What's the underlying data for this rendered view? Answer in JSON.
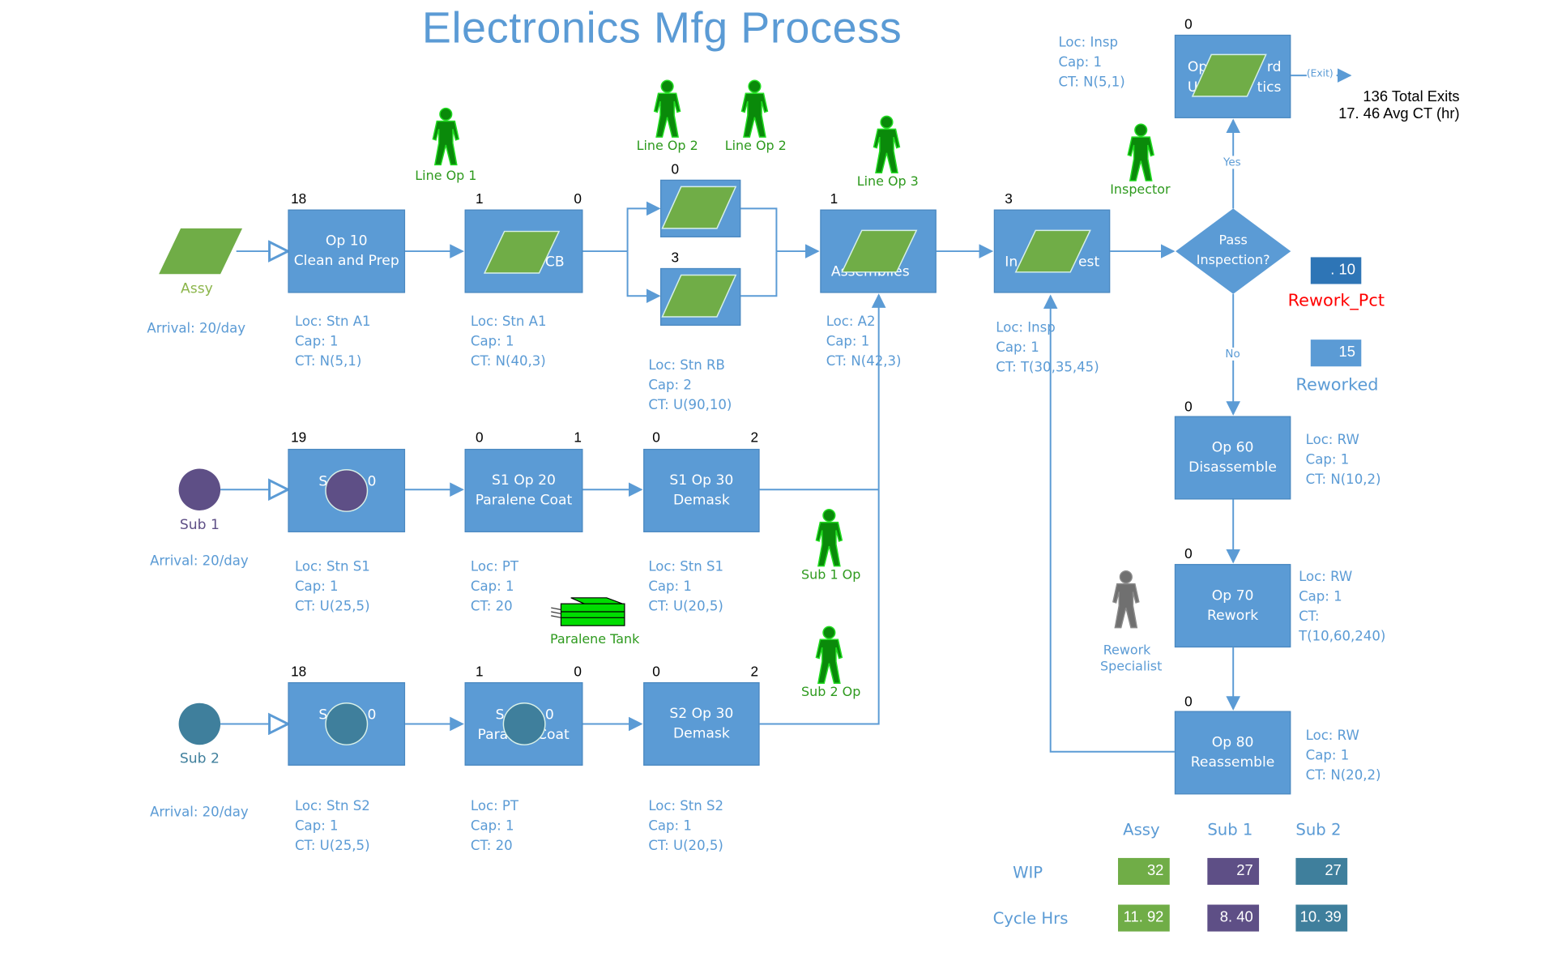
{
  "title": "Electronics Mfg Process",
  "colors": {
    "process_box": "#5b9bd5",
    "info_text": "#5b9bd5",
    "assy": "#70ad47",
    "sub1": "#5e4f86",
    "sub2": "#3f7f9c",
    "resource_green": "#0a8a0a",
    "resource_gray": "#707070",
    "rework_pct_label": "#ff0000",
    "rework_pct_box": "#2e75b6"
  },
  "entities": [
    {
      "name": "Assy",
      "shape": "parallelogram",
      "arrival": "Arrival: 20/day"
    },
    {
      "name": "Sub 1",
      "shape": "circle",
      "arrival": "Arrival: 20/day"
    },
    {
      "name": "Sub 2",
      "shape": "circle",
      "arrival": "Arrival: 20/day"
    }
  ],
  "resources": [
    {
      "name": "Line Op 1",
      "color": "green"
    },
    {
      "name": "Line Op 2",
      "color": "green"
    },
    {
      "name": "Line Op 2",
      "color": "green"
    },
    {
      "name": "Line Op 3",
      "color": "green"
    },
    {
      "name": "Inspector",
      "color": "green"
    },
    {
      "name": "Sub 1 Op",
      "color": "green"
    },
    {
      "name": "Sub 2 Op",
      "color": "green"
    },
    {
      "name": "Rework Specialist",
      "color": "gray"
    },
    {
      "name": "Paralene Tank",
      "color": "green",
      "icon": "tank"
    }
  ],
  "operations": {
    "op10": {
      "line1": "Op 10",
      "line2": "Clean and Prep",
      "count_left": "18",
      "count_right": "",
      "loc": "Loc: Stn A1",
      "cap": "Cap: 1",
      "ct": "CT: N(5,1)"
    },
    "op20": {
      "line1": "",
      "line2": "CB",
      "count_left": "1",
      "count_right": "0",
      "loc": "Loc: Stn A1",
      "cap": "Cap: 1",
      "ct": "CT: N(40,3)"
    },
    "op30a": {
      "count_left": "0",
      "loc": "",
      "cap": "",
      "ct": ""
    },
    "op30b": {
      "count_left": "3",
      "loc": "Loc: Stn RB",
      "cap": "Cap: 2",
      "ct": "CT: U(90,10)"
    },
    "op40": {
      "line2": "Assemblies",
      "count_left": "1",
      "loc": "Loc: A2",
      "cap": "Cap: 1",
      "ct": "CT: N(42,3)"
    },
    "op50": {
      "line1": "In",
      "line1b": "est",
      "count_left": "3",
      "loc": "Loc: Insp",
      "cap": "Cap: 1",
      "ct": "CT: T(30,35,45)"
    },
    "decision": {
      "line1": "Pass",
      "line2": "Inspection?",
      "yes": "Yes",
      "no": "No"
    },
    "op_final": {
      "line1a": "Op",
      "line1b": "rd",
      "line2a": "U",
      "line2b": "tics",
      "count_left": "0",
      "loc": "Loc: Insp",
      "cap": "Cap: 1",
      "ct": "CT: N(5,1)"
    },
    "op60": {
      "line1": "Op 60",
      "line2": "Disassemble",
      "count_left": "0",
      "loc": "Loc: RW",
      "cap": "Cap: 1",
      "ct": "CT: N(10,2)"
    },
    "op70": {
      "line1": "Op 70",
      "line2": "Rework",
      "count_left": "0",
      "loc": "Loc: RW",
      "cap": "Cap: 1",
      "ct": "CT:",
      "ct2": "T(10,60,240)"
    },
    "op80": {
      "line1": "Op 80",
      "line2": "Reassemble",
      "count_left": "0",
      "loc": "Loc: RW",
      "cap": "Cap: 1",
      "ct": "CT: N(20,2)"
    },
    "s1op10": {
      "line1": "S",
      "line1b": "0",
      "count_left": "19",
      "loc": "Loc: Stn S1",
      "cap": "Cap: 1",
      "ct": "CT: U(25,5)"
    },
    "s1op20": {
      "line1": "S1 Op 20",
      "line2": "Paralene Coat",
      "count_left": "0",
      "count_right": "1",
      "loc": "Loc: PT",
      "cap": "Cap: 1",
      "ct": "CT: 20"
    },
    "s1op30": {
      "line1": "S1 Op 30",
      "line2": "Demask",
      "count_left": "0",
      "count_right": "2",
      "loc": "Loc: Stn S1",
      "cap": "Cap: 1",
      "ct": "CT: U(20,5)"
    },
    "s2op10": {
      "line1": "S",
      "line1b": "0",
      "count_left": "18",
      "loc": "Loc: Stn S2",
      "cap": "Cap: 1",
      "ct": "CT: U(25,5)"
    },
    "s2op20": {
      "line1": "S",
      "line1b": "0",
      "line2a": "Para",
      "line2b": "Coat",
      "count_left": "1",
      "count_right": "0",
      "loc": "Loc: PT",
      "cap": "Cap: 1",
      "ct": "CT: 20"
    },
    "s2op30": {
      "line1": "S2 Op 30",
      "line2": "Demask",
      "count_left": "0",
      "count_right": "2",
      "loc": "Loc: Stn S2",
      "cap": "Cap: 1",
      "ct": "CT: U(20,5)"
    }
  },
  "exit": {
    "label": "(Exit)",
    "total_exits_value": "136",
    "total_exits_label": "Total Exits",
    "avg_ct_value": "17. 46",
    "avg_ct_label": "Avg CT (hr)"
  },
  "rework_pct": {
    "value": ". 10",
    "label": "Rework_Pct"
  },
  "reworked": {
    "value": "15",
    "label": "Reworked"
  },
  "stats_table": {
    "columns": [
      "Assy",
      "Sub 1",
      "Sub 2"
    ],
    "rows": [
      {
        "label": "WIP",
        "values": [
          "32",
          "27",
          "27"
        ]
      },
      {
        "label": "Cycle Hrs",
        "values": [
          "11. 92",
          "8. 40",
          "10. 39"
        ]
      }
    ]
  }
}
